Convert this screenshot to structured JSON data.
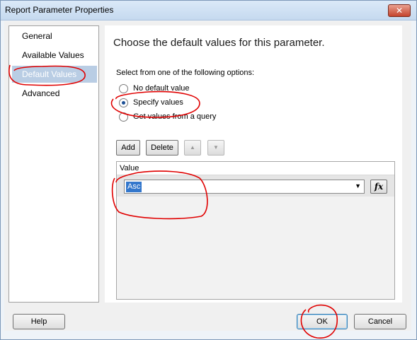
{
  "window": {
    "title": "Report Parameter Properties",
    "close_label": "✕"
  },
  "nav": {
    "items": [
      {
        "label": "General",
        "selected": false
      },
      {
        "label": "Available Values",
        "selected": false
      },
      {
        "label": "Default Values",
        "selected": true
      },
      {
        "label": "Advanced",
        "selected": false
      }
    ]
  },
  "main": {
    "heading": "Choose the default values for this parameter.",
    "options_label": "Select from one of the following options:",
    "options": [
      {
        "label": "No default value",
        "checked": false
      },
      {
        "label": "Specify values",
        "checked": true
      },
      {
        "label": "Get values from a query",
        "checked": false
      }
    ],
    "toolbar": {
      "add_label": "Add",
      "delete_label": "Delete",
      "up_icon": "▲",
      "down_icon": "▼"
    },
    "grid": {
      "column_header": "Value",
      "rows": [
        {
          "value": "Asc"
        }
      ],
      "dropdown_icon": "▼",
      "fx_label": "fx"
    }
  },
  "footer": {
    "help_label": "Help",
    "ok_label": "OK",
    "cancel_label": "Cancel"
  },
  "colors": {
    "selected_nav": "#b9cde4",
    "annotation": "#e00000",
    "selection": "#3377cc"
  }
}
